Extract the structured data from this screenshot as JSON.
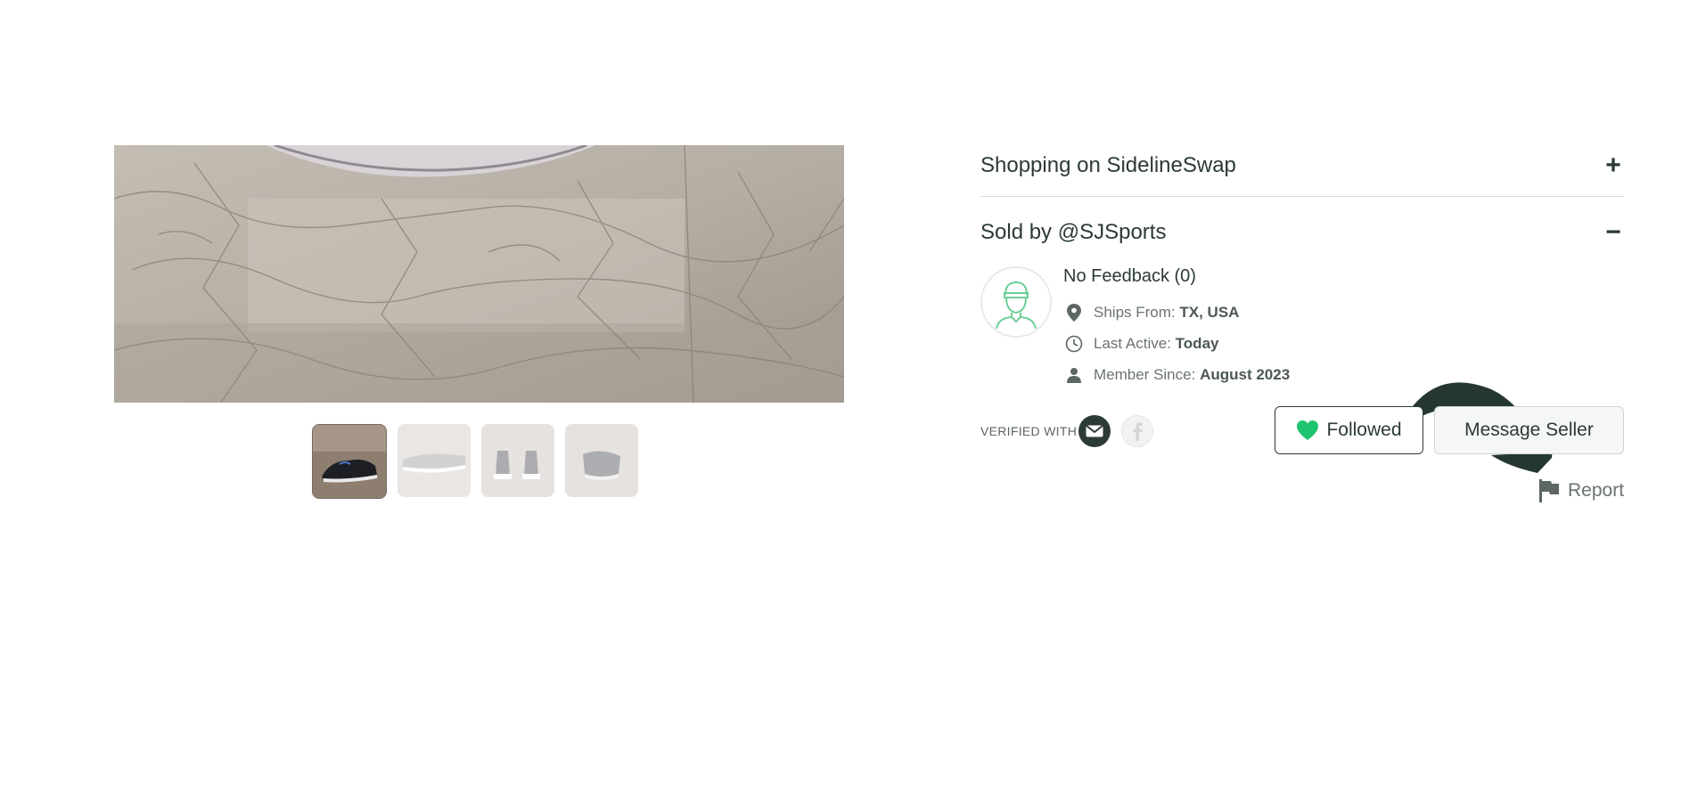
{
  "gallery": {
    "thumbnail_count": 4,
    "active_thumbnail": 1
  },
  "accordion": {
    "shopping": {
      "label": "Shopping on SidelineSwap",
      "toggle": "+"
    },
    "sold_by": {
      "label": "Sold by @SJSports",
      "toggle": "−"
    }
  },
  "seller": {
    "feedback": "No Feedback (0)",
    "ships_from_label": "Ships From:",
    "ships_from_value": "TX, USA",
    "last_active_label": "Last Active:",
    "last_active_value": "Today",
    "member_since_label": "Member Since:",
    "member_since_value": "August 2023",
    "verified_label": "VERIFIED WITH",
    "verified_icons": [
      "email-icon",
      "facebook-icon"
    ]
  },
  "actions": {
    "followed_label": "Followed",
    "message_label": "Message Seller",
    "report_label": "Report"
  },
  "colors": {
    "text_dark": "#2b3a35",
    "accent_green": "#1fc46e",
    "arrow": "#25382f"
  }
}
